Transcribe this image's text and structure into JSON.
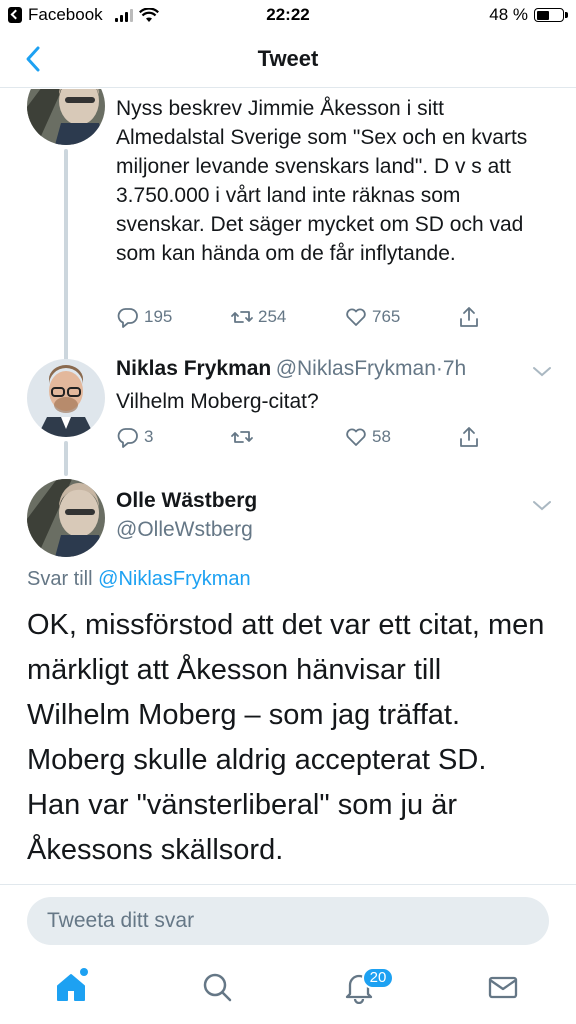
{
  "status_bar": {
    "back_app": "Facebook",
    "time": "22:22",
    "battery_text": "48 %",
    "battery_level": 0.48
  },
  "header": {
    "title": "Tweet"
  },
  "tweets": [
    {
      "text": "Nyss beskrev Jimmie Åkesson i sitt Almedalstal Sverige som \"Sex och en kvarts miljoner levande svenskars land\". D v s att 3.750.000 i vårt land inte räknas som svenskar. Det säger mycket om SD och vad som kan hända om de får inflytande.",
      "reply_count": "195",
      "retweet_count": "254",
      "like_count": "765"
    },
    {
      "name": "Niklas Frykman",
      "handle": "@NiklasFrykman",
      "separator": "·",
      "time": "7h",
      "text": "Vilhelm Moberg-citat?",
      "reply_count": "3",
      "retweet_count": "",
      "like_count": "58"
    }
  ],
  "main_tweet": {
    "name": "Olle Wästberg",
    "handle": "@OlleWstberg",
    "reply_to_prefix": "Svar till",
    "reply_to_handle": "@NiklasFrykman",
    "text_lines": [
      "OK, missförstod att det var ett citat, men",
      "märkligt att Åkesson hänvisar till",
      "Wilhelm Moberg – som jag träffat.",
      "Moberg skulle aldrig accepterat SD.",
      "Han var \"vänsterliberal\" som ju är",
      "Åkessons skällsord."
    ]
  },
  "reply_bar": {
    "placeholder": "Tweeta ditt svar"
  },
  "tab_bar": {
    "notifications_badge": "20",
    "tabs": [
      "home-icon",
      "search-icon",
      "notifications-icon",
      "messages-icon"
    ]
  },
  "colors": {
    "accent": "#1da1f2",
    "secondary_text": "#657786",
    "divider": "#e1e8ed"
  }
}
